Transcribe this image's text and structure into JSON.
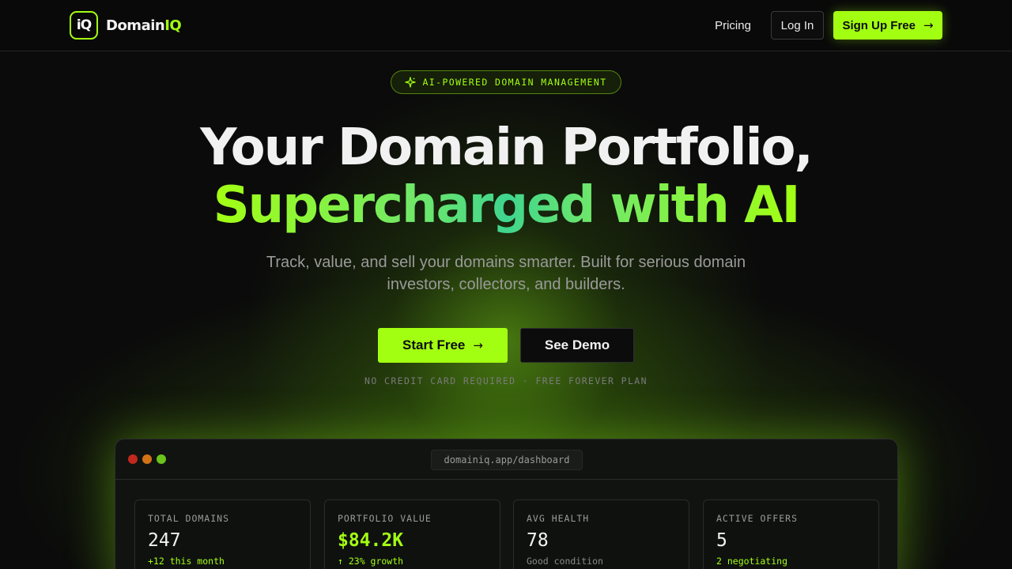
{
  "brand": {
    "mark_prefix": "i",
    "mark_suffix": "Q",
    "name_prefix": "Domain",
    "name_suffix": "IQ",
    "accent_color": "#a3ff12"
  },
  "nav": {
    "pricing_label": "Pricing",
    "login_label": "Log In",
    "signup_label": "Sign Up Free",
    "signup_icon": "arrow-right-icon"
  },
  "badge": {
    "icon": "sparkle-icon",
    "text": "AI-POWERED DOMAIN MANAGEMENT"
  },
  "hero": {
    "line1": "Your Domain Portfolio,",
    "line2": "Supercharged with AI",
    "subtitle": "Track, value, and sell your domains smarter. Built for serious domain investors, collectors, and builders.",
    "primary_cta": "Start Free",
    "secondary_cta": "See Demo",
    "note": "NO CREDIT CARD REQUIRED · FREE FOREVER PLAN"
  },
  "preview": {
    "url": "domainiq.app/dashboard",
    "window_dots": [
      "#c1291d",
      "#d27315",
      "#6ac41a"
    ],
    "cards": [
      {
        "label": "TOTAL DOMAINS",
        "value": "247",
        "sub": "+12 this month"
      },
      {
        "label": "PORTFOLIO VALUE",
        "value": "$84.2K",
        "sub": "↑ 23% growth"
      },
      {
        "label": "AVG HEALTH",
        "value": "78",
        "sub": "Good condition"
      },
      {
        "label": "ACTIVE OFFERS",
        "value": "5",
        "sub": "2 negotiating"
      }
    ]
  }
}
